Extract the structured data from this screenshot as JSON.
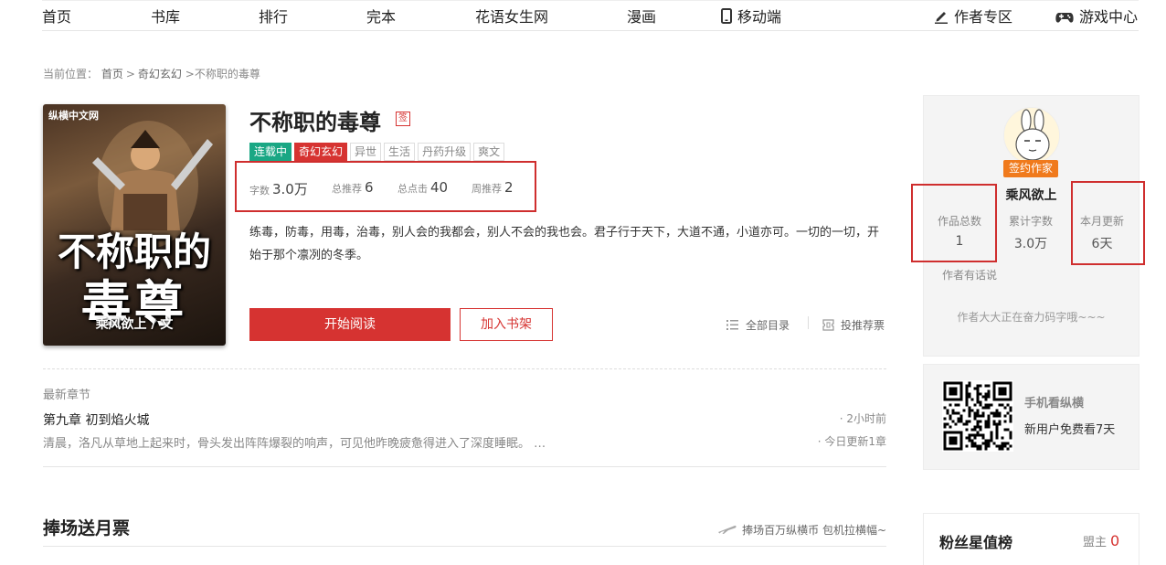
{
  "nav": {
    "items": [
      "首页",
      "书库",
      "排行",
      "完本",
      "花语女生网",
      "漫画",
      "移动端"
    ],
    "author_zone": "作者专区",
    "game_center": "游戏中心"
  },
  "breadcrumb": {
    "prefix": "当前位置：",
    "home": "首页",
    "category": "奇幻玄幻",
    "book": ">不称职的毒尊"
  },
  "book": {
    "cover": {
      "publisher": "纵横中文网",
      "title_line1": "不称职的",
      "title_line2": "毒尊",
      "byline": "乘风欲上 / 文"
    },
    "title": "不称职的毒尊",
    "sign_badge": "签",
    "tags": [
      "连载中",
      "奇幻玄幻",
      "异世",
      "生活",
      "丹药升级",
      "爽文"
    ],
    "stats": [
      {
        "label": "字数",
        "value": "3.0万"
      },
      {
        "label": "总推荐",
        "value": "6"
      },
      {
        "label": "总点击",
        "value": "40"
      },
      {
        "label": "周推荐",
        "value": "2"
      }
    ],
    "intro": "练毒，防毒，用毒，治毒，别人会的我都会，别人不会的我也会。君子行于天下，大道不通，小道亦可。一切的一切，开始于那个凛冽的冬季。",
    "read_button": "开始阅读",
    "shelf_button": "加入书架",
    "catalog_link": "全部目录",
    "vote_link": "投推荐票"
  },
  "latest": {
    "label": "最新章节",
    "chapter_title": "第九章 初到焰火城",
    "time": "· 2小时前",
    "snippet": "清晨，洛凡从草地上起来时，骨头发出阵阵爆裂的响声，可见他昨晚疲惫得进入了深度睡眠。 …",
    "update": "· 今日更新1章"
  },
  "support": {
    "title": "捧场送月票",
    "link": "捧场百万纵横币 包机拉横幅~"
  },
  "author": {
    "signed_label": "签约作家",
    "name": "乘风欲上",
    "works_label": "作品总数",
    "works_value": "1",
    "words_label": "累计字数",
    "words_value": "3.0万",
    "update_label": "本月更新",
    "update_value": "6天",
    "says_label": "作者有话说",
    "message": "作者大大正在奋力码字哦~~~"
  },
  "mobile": {
    "title": "手机看纵横",
    "subtitle": "新用户免费看7天"
  },
  "fans": {
    "title": "粉丝星值榜",
    "role": "盟主",
    "count": "0"
  }
}
